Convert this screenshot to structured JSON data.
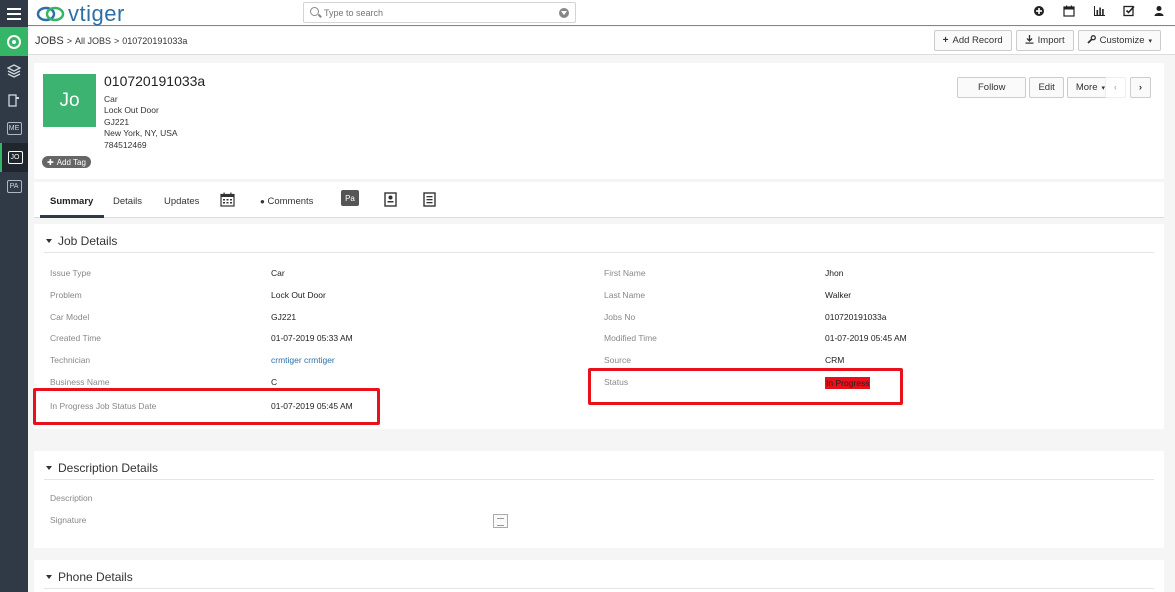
{
  "app": {
    "logo_text": "vtiger"
  },
  "search": {
    "placeholder": "Type to search"
  },
  "sidebar": {
    "items": [
      {
        "label": "ME"
      },
      {
        "label": "JO"
      },
      {
        "label": "PA"
      }
    ]
  },
  "breadcrumb": {
    "module": "JOBS",
    "list": "All JOBS",
    "record": "010720191033a"
  },
  "toolbar": {
    "add_record": "Add Record",
    "import": "Import",
    "customize": "Customize"
  },
  "record": {
    "avatar": "Jo",
    "title": "010720191033a",
    "lines": [
      "Car",
      "Lock Out Door",
      "GJ221",
      "New York, NY, USA",
      "784512469"
    ],
    "add_tag": "Add Tag",
    "follow": "Follow",
    "edit": "Edit",
    "more": "More"
  },
  "tabs": {
    "summary": "Summary",
    "details": "Details",
    "updates": "Updates",
    "comments": "Comments",
    "pa": "Pa"
  },
  "job_details": {
    "title": "Job Details",
    "left": [
      {
        "label": "Issue Type",
        "value": "Car"
      },
      {
        "label": "Problem",
        "value": "Lock Out Door"
      },
      {
        "label": "Car Model",
        "value": "GJ221"
      },
      {
        "label": "Created Time",
        "value": "01-07-2019 05:33 AM"
      },
      {
        "label": "Technician",
        "value": "crmtiger crmtiger"
      },
      {
        "label": "Business Name",
        "value": "C"
      },
      {
        "label": "In Progress Job Status Date",
        "value": "01-07-2019 05:45 AM"
      }
    ],
    "right": [
      {
        "label": "First Name",
        "value": "Jhon"
      },
      {
        "label": "Last Name",
        "value": "Walker"
      },
      {
        "label": "Jobs No",
        "value": "010720191033a"
      },
      {
        "label": "Modified Time",
        "value": "01-07-2019 05:45 AM"
      },
      {
        "label": "Source",
        "value": "CRM"
      },
      {
        "label": "Status",
        "value": "In Progress"
      }
    ]
  },
  "description_details": {
    "title": "Description Details",
    "fields": [
      {
        "label": "Description"
      },
      {
        "label": "Signature"
      }
    ]
  },
  "phone_details": {
    "title": "Phone Details"
  },
  "colors": {
    "accent": "#35b566",
    "status_red": "#e8101b",
    "link": "#2d6fa8"
  }
}
